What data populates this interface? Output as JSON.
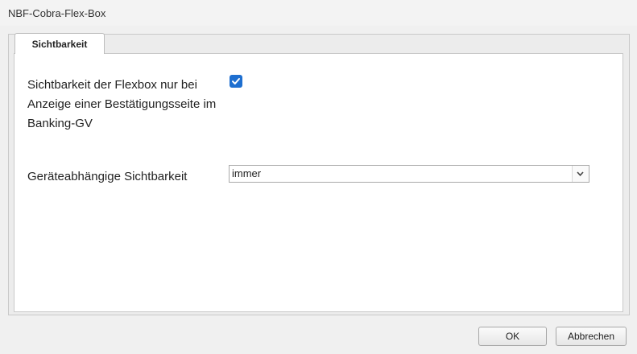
{
  "window": {
    "title": "NBF-Cobra-Flex-Box"
  },
  "tabs": [
    {
      "label": "Sichtbarkeit",
      "active": true
    }
  ],
  "form": {
    "visibility_label": "Sichtbarkeit der Flexbox nur bei Anzeige einer Bestätigungsseite im Banking-GV",
    "visibility_checked": true,
    "device_label": "Geräteabhängige Sichtbarkeit",
    "device_value": "immer"
  },
  "buttons": {
    "ok": "OK",
    "cancel": "Abbrechen"
  },
  "colors": {
    "checkbox_accent": "#1e6fd0",
    "dialog_bg": "#f0f0f0",
    "panel_bg": "#ffffff"
  },
  "icons": {
    "checkbox": "checkmark-icon",
    "dropdown": "chevron-down-icon"
  }
}
